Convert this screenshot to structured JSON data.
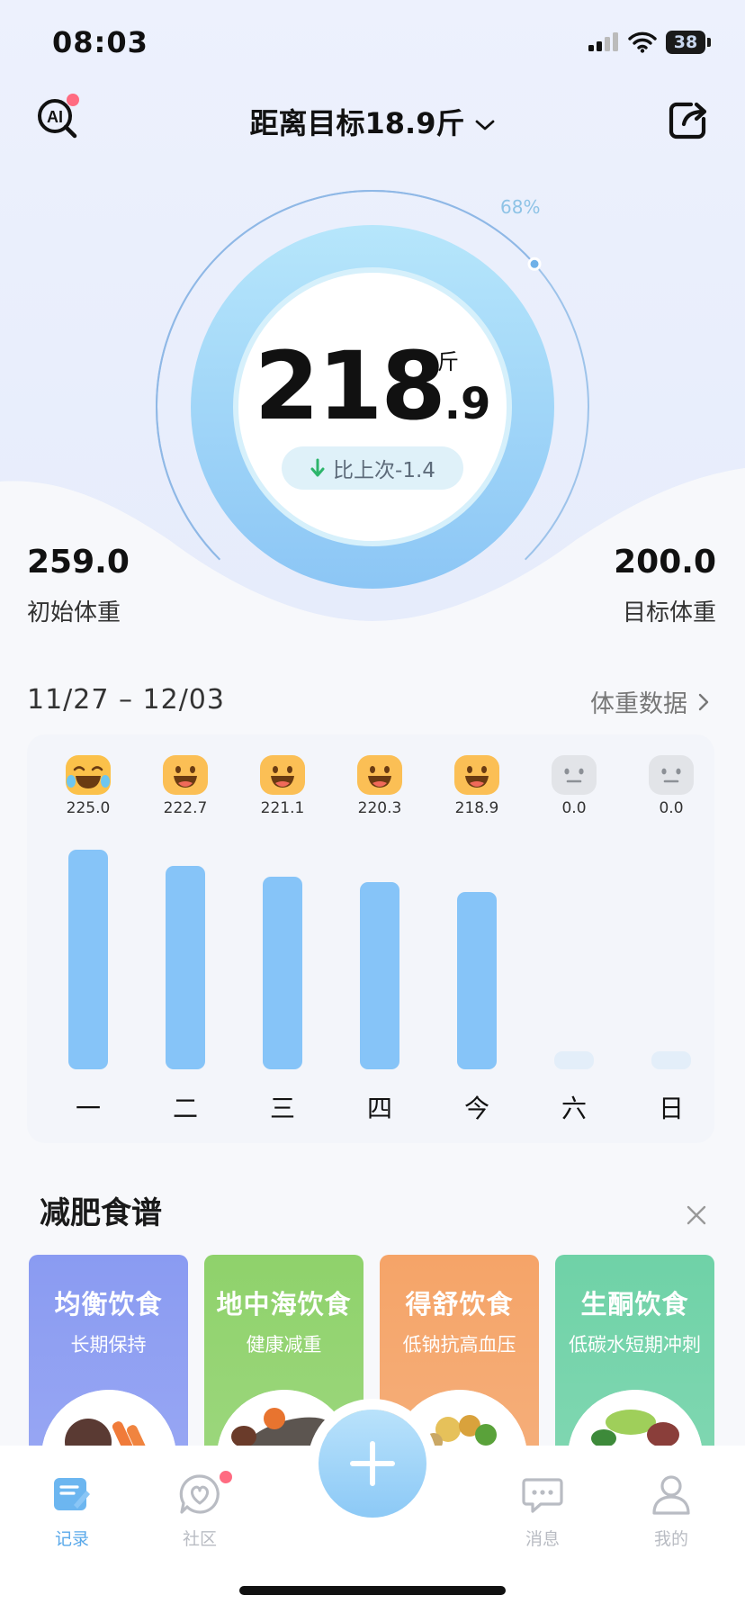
{
  "status_bar": {
    "time": "08:03",
    "battery": "38"
  },
  "header": {
    "title": "距离目标18.9斤",
    "ai_label": "AI"
  },
  "gauge": {
    "progress_label": "68%",
    "progress": 0.68,
    "weight_int": "218",
    "weight_dec": ".9",
    "unit": "斤",
    "diff_label": "比上次-1.4",
    "colors": {
      "ring": "#9cd3f8",
      "accent": "#86c4f8"
    }
  },
  "stats": {
    "start_value": "259.0",
    "start_label": "初始体重",
    "target_value": "200.0",
    "target_label": "目标体重"
  },
  "week": {
    "range": "11/27 – 12/03",
    "link_label": "体重数据",
    "days": [
      {
        "label": "一",
        "value": "225.0",
        "weight": 225.0,
        "mood": "laugh-tears-face-icon",
        "recorded": true
      },
      {
        "label": "二",
        "value": "222.7",
        "weight": 222.7,
        "mood": "grin-face-icon",
        "recorded": true
      },
      {
        "label": "三",
        "value": "221.1",
        "weight": 221.1,
        "mood": "grin-face-icon",
        "recorded": true
      },
      {
        "label": "四",
        "value": "220.3",
        "weight": 220.3,
        "mood": "grin-face-icon",
        "recorded": true
      },
      {
        "label": "今",
        "value": "218.9",
        "weight": 218.9,
        "mood": "grin-face-icon",
        "recorded": true
      },
      {
        "label": "六",
        "value": "0.0",
        "weight": 0.0,
        "mood": "neutral-face-icon",
        "recorded": false
      },
      {
        "label": "日",
        "value": "0.0",
        "weight": 0.0,
        "mood": "neutral-face-icon",
        "recorded": false
      }
    ]
  },
  "recipes": {
    "title": "减肥食谱",
    "cards": [
      {
        "name": "均衡饮食",
        "sub": "长期保持",
        "color": "#8a9bf2"
      },
      {
        "name": "地中海饮食",
        "sub": "健康减重",
        "color": "#8fd26b"
      },
      {
        "name": "得舒饮食",
        "sub": "低钠抗高血压",
        "color": "#f5a468"
      },
      {
        "name": "生酮饮食",
        "sub": "低碳水短期冲刺",
        "color": "#6fd2a7"
      }
    ]
  },
  "tabbar": {
    "items": [
      {
        "label": "记录",
        "active": true
      },
      {
        "label": "社区",
        "active": false
      },
      {
        "label": "消息",
        "active": false
      },
      {
        "label": "我的",
        "active": false
      }
    ],
    "active_color": "#5aa9ea",
    "inactive_color": "#b9bcc3"
  }
}
